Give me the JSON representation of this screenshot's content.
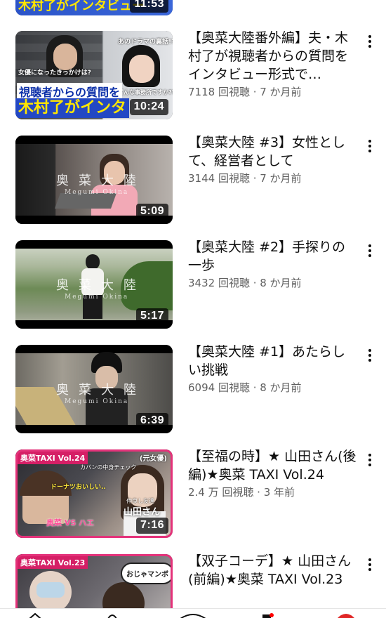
{
  "top_thumb": {
    "text": "木村了がインタビュー",
    "duration": "11:53"
  },
  "videos": [
    {
      "title": "【奥菜大陸番外編】夫・木村了が視聴者からの質問をインタビュー形式で…",
      "meta": "7118 回視聴 · 7 か月前",
      "duration": "10:24",
      "overlay_line1": "視聴者からの質問を",
      "overlay_line2": "木村了がインタ",
      "overlay_small1": "女優になったきっかけは?",
      "overlay_small2": "あのドラマの裏話!?",
      "overlay_small3": "どんな事務所ですか??"
    },
    {
      "title": "【奥菜大陸 #3】女性として、経営者として",
      "meta": "3144 回視聴 · 7 か月前",
      "duration": "5:09",
      "watermark": "奥菜大陸",
      "watermark_sub": "Megumi Okina"
    },
    {
      "title": "【奥菜大陸 #2】手探りの一歩",
      "meta": "3432 回視聴 · 8 か月前",
      "duration": "5:17",
      "watermark": "奥菜大陸",
      "watermark_sub": "Megumi Okina"
    },
    {
      "title": "【奥菜大陸 #1】あたらしい挑戦",
      "meta": "6094 回視聴 · 8 か月前",
      "duration": "6:39",
      "watermark": "奥菜大陸",
      "watermark_sub": "Megumi Okina"
    },
    {
      "title": "【至福の時】★ 山田さん(後編)★奥菜 TAXI Vol.24",
      "meta": "2.4 万 回視聴 · 3 年前",
      "duration": "7:16",
      "label": "奥菜TAXI Vol.24",
      "overlay_small1": "(元女優)",
      "overlay_small2": "カバンの中身チェック",
      "overlay_small3": "ドーナツおいしい..",
      "overlay_small4": "奥菜 VS ハエ",
      "overlay_small5": "山田さん",
      "overlay_small6": "仲良し友達"
    },
    {
      "title": "【双子コーデ】★ 山田さん(前編)★奥菜 TAXI Vol.23",
      "meta": "",
      "duration": "",
      "label": "奥菜TAXI Vol.23",
      "overlay_small1": "おじゃマンボ"
    }
  ],
  "icons": {
    "more": "kebab-vertical-icon"
  },
  "colors": {
    "taxi_accent": "#e4327a",
    "meta_text": "#606060"
  }
}
